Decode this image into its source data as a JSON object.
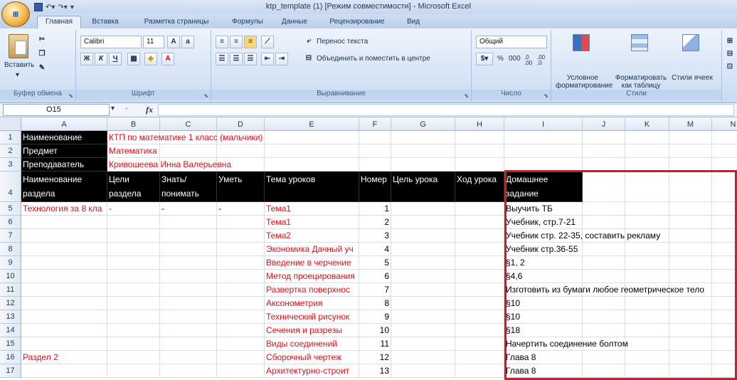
{
  "window": {
    "title": "ktp_template (1)  [Режим совместимости] - Microsoft Excel",
    "office_button": "Office"
  },
  "tabs": [
    "Главная",
    "Вставка",
    "Разметка страницы",
    "Формулы",
    "Данные",
    "Рецензирование",
    "Вид"
  ],
  "ribbon": {
    "clipboard": {
      "label": "Буфер обмена",
      "paste": "Вставить"
    },
    "font": {
      "label": "Шрифт",
      "name": "Calibri",
      "size": "11",
      "bold": "Ж",
      "italic": "К",
      "underline": "Ч"
    },
    "alignment": {
      "label": "Выравнивание",
      "wrap_text": "Перенос текста",
      "merge_center": "Объединить и поместить в центре"
    },
    "number": {
      "label": "Число",
      "format": "Общий",
      "percent": "%",
      "thousands": "000",
      "inc_decimal": ",0 ,00",
      "dec_decimal": ",00 ,0"
    },
    "styles": {
      "label": "Стили",
      "conditional": "Условное форматирование",
      "as_table": "Форматировать как таблицу",
      "cell_styles": "Стили ячеек"
    }
  },
  "formula_bar": {
    "cell_ref": "O15",
    "fx": "fx",
    "value": ""
  },
  "grid": {
    "columns": [
      "A",
      "B",
      "C",
      "D",
      "E",
      "F",
      "G",
      "H",
      "I",
      "J",
      "K",
      "M",
      "N"
    ],
    "rows": [
      "1",
      "2",
      "3",
      "4",
      "5",
      "6",
      "7",
      "8",
      "9",
      "10",
      "11",
      "12",
      "13",
      "14",
      "15",
      "16",
      "17"
    ],
    "r1": {
      "a": "Наименование",
      "b": "КТП по математике 1 класс (мальчики)"
    },
    "r2": {
      "a": "Предмет",
      "b": "Математика"
    },
    "r3": {
      "a": "Преподаватель",
      "b": "Кривошеева Инна Валерьевна"
    },
    "r4": {
      "a": "Наименование раздела",
      "b": "Цели раздела",
      "c": "Знать/понимать",
      "d": "Уметь",
      "e": "Тема уроков",
      "f": "Номер",
      "g": "Цель урока",
      "h": "Ход урока",
      "i": "Домашнее задание"
    },
    "r5": {
      "a": "Технология за 8 кла",
      "b": "-",
      "c": "-",
      "d": "-",
      "e": "Тема1",
      "f": "1",
      "i": "Выучить ТБ"
    },
    "r6": {
      "e": "Тема1",
      "f": "2",
      "i": "Учебник, стр.7-21"
    },
    "r7": {
      "e": "Тема2",
      "f": "3",
      "i": "Учебник стр. 22-35, составить рекламу"
    },
    "r8": {
      "e": "Экономика Дачный уч",
      "f": "4",
      "i": "Учебник  стр.36-55"
    },
    "r9": {
      "e": "Введение в черчение",
      "f": "5",
      "i": "§1, 2"
    },
    "r10": {
      "e": "Метод проецирования",
      "f": "6",
      "i": "§4,6"
    },
    "r11": {
      "e": "Развертка поверхнос",
      "f": "7",
      "i": "Изготовить из бумаги любое геометрическое тело"
    },
    "r12": {
      "e": "Аксонометрия",
      "f": "8",
      "i": "§10"
    },
    "r13": {
      "e": "Технический рисунок",
      "f": "9",
      "i": "§10"
    },
    "r14": {
      "e": "Сечения и разрезы",
      "f": "10",
      "i": "§18"
    },
    "r15": {
      "e": "Виды соединений",
      "f": "11",
      "i": "Начертить соединение болтом"
    },
    "r16": {
      "a": "Раздел 2",
      "e": "Сборочный чертеж",
      "f": "12",
      "i": "Глава 8"
    },
    "r17": {
      "e": "Архитектурно-строит",
      "f": "13",
      "i": "Глава 8"
    }
  },
  "colors": {
    "accent_red": "#e0131f",
    "header_black": "#000000",
    "ribbon_blue": "#d5e3f5"
  }
}
